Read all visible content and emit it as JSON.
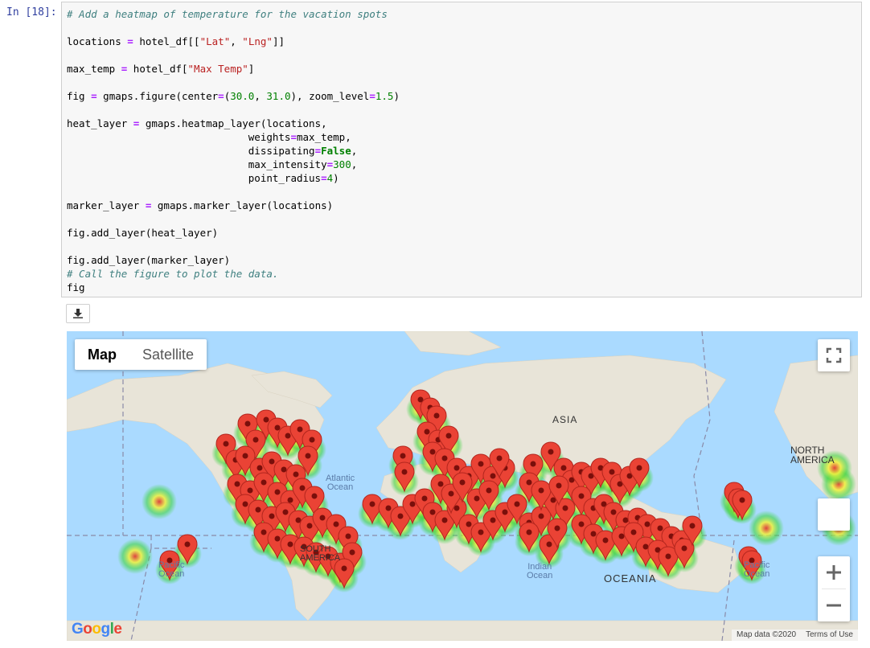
{
  "notebook": {
    "prompt": "In [18]:",
    "code_lines": [
      [
        {
          "t": "# Add a heatmap of temperature for the vacation spots",
          "c": "com"
        }
      ],
      [],
      [
        {
          "t": "locations "
        },
        {
          "t": "=",
          "c": "op"
        },
        {
          "t": " hotel_df[["
        },
        {
          "t": "\"Lat\"",
          "c": "str"
        },
        {
          "t": ", "
        },
        {
          "t": "\"Lng\"",
          "c": "str"
        },
        {
          "t": "]]"
        }
      ],
      [],
      [
        {
          "t": "max_temp "
        },
        {
          "t": "=",
          "c": "op"
        },
        {
          "t": " hotel_df["
        },
        {
          "t": "\"Max Temp\"",
          "c": "str"
        },
        {
          "t": "]"
        }
      ],
      [],
      [
        {
          "t": "fig "
        },
        {
          "t": "=",
          "c": "op"
        },
        {
          "t": " gmaps.figure(center"
        },
        {
          "t": "=",
          "c": "op"
        },
        {
          "t": "("
        },
        {
          "t": "30.0",
          "c": "num"
        },
        {
          "t": ", "
        },
        {
          "t": "31.0",
          "c": "num"
        },
        {
          "t": "), zoom_level"
        },
        {
          "t": "=",
          "c": "op"
        },
        {
          "t": "1.5",
          "c": "num"
        },
        {
          "t": ")"
        }
      ],
      [],
      [
        {
          "t": "heat_layer "
        },
        {
          "t": "=",
          "c": "op"
        },
        {
          "t": " gmaps.heatmap_layer(locations,"
        }
      ],
      [
        {
          "t": "                              weights"
        },
        {
          "t": "=",
          "c": "op"
        },
        {
          "t": "max_temp,"
        }
      ],
      [
        {
          "t": "                              dissipating"
        },
        {
          "t": "=",
          "c": "op"
        },
        {
          "t": "False",
          "c": "kw"
        },
        {
          "t": ","
        }
      ],
      [
        {
          "t": "                              max_intensity"
        },
        {
          "t": "=",
          "c": "op"
        },
        {
          "t": "300",
          "c": "num"
        },
        {
          "t": ","
        }
      ],
      [
        {
          "t": "                              point_radius"
        },
        {
          "t": "=",
          "c": "op"
        },
        {
          "t": "4",
          "c": "num"
        },
        {
          "t": ")"
        }
      ],
      [],
      [
        {
          "t": "marker_layer "
        },
        {
          "t": "=",
          "c": "op"
        },
        {
          "t": " gmaps.marker_layer(locations)"
        }
      ],
      [],
      [
        {
          "t": "fig.add_layer(heat_layer)"
        }
      ],
      [],
      [
        {
          "t": "fig.add_layer(marker_layer)"
        }
      ],
      [
        {
          "t": "# Call the figure to plot the data.",
          "c": "com"
        }
      ],
      [
        {
          "t": "fig"
        }
      ]
    ],
    "download_icon": "download-icon"
  },
  "map": {
    "map_type_buttons": {
      "map": "Map",
      "satellite": "Satellite"
    },
    "labels": {
      "asia": "ASIA",
      "atlantic": "Atlantic\nOcean",
      "indian": "Indian\nOcean",
      "pacific_left": "Pacific\nOcean",
      "pacific_right": "Pacific\nOcean",
      "oceania": "OCEANIA",
      "north_america": "NORTH\nAMERICA",
      "south_america": "SOUTH\nAMERICA"
    },
    "footer": {
      "map_data": "Map data ©2020",
      "terms": "Terms of Use"
    },
    "google_logo": "Google",
    "icons": {
      "fullscreen": "fullscreen-icon",
      "pegman": "pegman-icon",
      "zoom_in": "zoom-in-icon",
      "zoom_out": "zoom-out-icon",
      "marker": "map-marker-icon"
    },
    "colors": {
      "ocean": "#aadaff",
      "land": "#e8e4d8",
      "marker": "#ea4335",
      "heat_green": "#3fd43f",
      "heat_yellow": "#f2f23a",
      "heat_red": "#e2332a"
    }
  }
}
